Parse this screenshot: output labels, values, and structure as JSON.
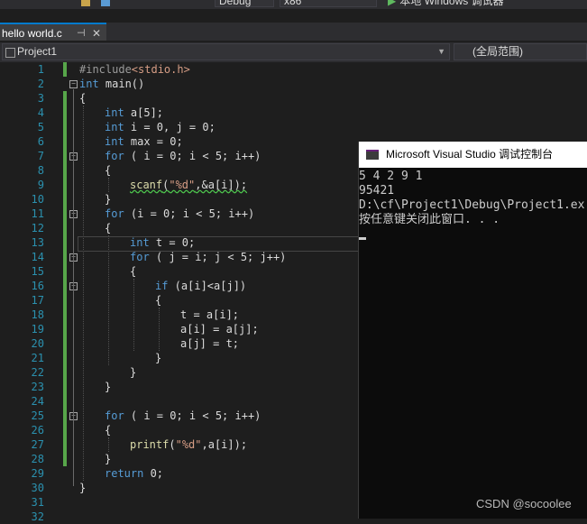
{
  "toolbar": {
    "config": "Debug",
    "platform": "x86",
    "run_label": "本地 Windows 调试器"
  },
  "tab": {
    "filename": "hello world.c",
    "pin": "⊣",
    "close": "✕"
  },
  "navbar": {
    "project": "Project1",
    "scope": "(全局范围)"
  },
  "editor": {
    "line_numbers": [
      "1",
      "2",
      "3",
      "4",
      "5",
      "6",
      "7",
      "8",
      "9",
      "10",
      "11",
      "12",
      "13",
      "14",
      "15",
      "16",
      "17",
      "18",
      "19",
      "20",
      "21",
      "22",
      "23",
      "24",
      "25",
      "26",
      "27",
      "28",
      "29",
      "30",
      "31",
      "32"
    ]
  },
  "code": {
    "l1": {
      "pp": "#include",
      "inc": "<stdio.h>"
    },
    "l2": {
      "kw": "int",
      "rest": " main()"
    },
    "l3": "{",
    "l4": {
      "kw": "int",
      "rest": " a[5];"
    },
    "l5": {
      "kw": "int",
      "rest": " i = 0, j = 0;"
    },
    "l6": {
      "kw": "int",
      "rest": " max = 0;"
    },
    "l7": {
      "kw": "for",
      "rest": " ( i = 0; i < 5; i++)"
    },
    "l8": "{",
    "l9": {
      "fn": "scanf",
      "p1": "(",
      "str": "\"%d\"",
      "rest": ",&a[i]);"
    },
    "l10": "}",
    "l11": {
      "kw": "for",
      "rest": " (i = 0; i < 5; i++)"
    },
    "l12": "{",
    "l13": {
      "kw": "int",
      "rest": " t = 0;"
    },
    "l14": {
      "kw": "for",
      "rest": " ( j = i; j < 5; j++)"
    },
    "l15": "{",
    "l16": {
      "kw": "if",
      "rest": " (a[i]<a[j])"
    },
    "l17": "{",
    "l18": "t = a[i];",
    "l19": "a[i] = a[j];",
    "l20": "a[j] = t;",
    "l21": "}",
    "l22": "}",
    "l23": "}",
    "l25": {
      "kw": "for",
      "rest": " ( i = 0; i < 5; i++)"
    },
    "l26": "{",
    "l27": {
      "fn": "printf",
      "p1": "(",
      "str": "\"%d\"",
      "rest": ",a[i]);"
    },
    "l28": "}",
    "l29": {
      "kw": "return",
      "rest": " 0;"
    },
    "l30": "}"
  },
  "console": {
    "title": "Microsoft Visual Studio 调试控制台",
    "lines": [
      "5 4 2 9 1",
      "95421",
      "D:\\cf\\Project1\\Debug\\Project1.ex",
      "按任意键关闭此窗口. . ."
    ]
  },
  "watermark": "CSDN @socoolee"
}
